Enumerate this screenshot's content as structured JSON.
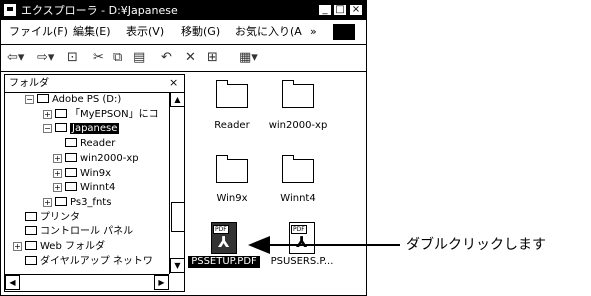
{
  "window": {
    "title": "エクスプローラ - D:¥Japanese",
    "controls": [
      "_",
      "□",
      "×"
    ]
  },
  "menu": {
    "items": [
      "ファイル(F)",
      "編集(E)",
      "表示(V)",
      "移動(G)",
      "お気に入り(A"
    ],
    "more": "»"
  },
  "toolbar": {
    "icons": [
      "back-icon",
      "forward-icon",
      "up-folder-icon",
      "cut-icon",
      "copy-icon",
      "paste-icon",
      "undo-icon",
      "delete-icon",
      "properties-icon",
      "views-icon"
    ]
  },
  "folder_pane": {
    "title": "フォルダ",
    "close": "×",
    "tree": [
      {
        "label": "Adobe PS (D:)",
        "expander": "⊟"
      },
      {
        "label": "「MyEPSON」にコ",
        "expander": "⊞"
      },
      {
        "label": "Japanese",
        "expander": "⊟",
        "selected": true
      },
      {
        "label": "Reader",
        "expander": ""
      },
      {
        "label": "win2000-xp",
        "expander": "⊞"
      },
      {
        "label": "Win9x",
        "expander": "⊞"
      },
      {
        "label": "Winnt4",
        "expander": "⊞"
      },
      {
        "label": "Ps3_fnts",
        "expander": "⊞"
      },
      {
        "label": "プリンタ",
        "expander": ""
      },
      {
        "label": "コントロール パネル",
        "expander": ""
      },
      {
        "label": "Web フォルダ",
        "expander": "⊞"
      },
      {
        "label": "ダイヤルアップ ネットワ",
        "expander": ""
      }
    ]
  },
  "files": [
    {
      "label": "Reader",
      "type": "folder"
    },
    {
      "label": "win2000-xp",
      "type": "folder"
    },
    {
      "label": "Win9x",
      "type": "folder"
    },
    {
      "label": "Winnt4",
      "type": "folder"
    },
    {
      "label": "PSSETUP.PDF",
      "type": "pdf",
      "selected": true
    },
    {
      "label": "PSUSERS.P...",
      "type": "pdf"
    }
  ],
  "annotation": {
    "text": "ダブルクリックします"
  }
}
